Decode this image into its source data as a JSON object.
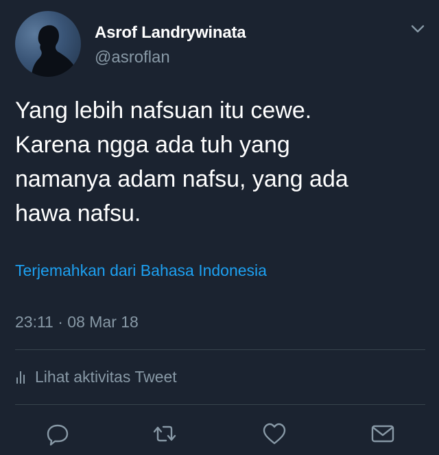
{
  "user": {
    "display_name": "Asrof Landrywinata",
    "handle": "@asroflan",
    "avatar_icon": "avatar-silhouette"
  },
  "tweet": {
    "text_lines": [
      "Yang lebih nafsuan itu cewe.",
      "Karena ngga ada tuh yang",
      "namanya adam nafsu, yang ada",
      "hawa nafsu."
    ],
    "translate_label": "Terjemahkan dari Bahasa Indonesia",
    "timestamp": "23:11 · 08 Mar 18",
    "activity_label": "Lihat aktivitas Tweet"
  },
  "actions": {
    "reply_icon": "reply-icon",
    "retweet_icon": "retweet-icon",
    "like_icon": "like-icon",
    "dm_icon": "mail-icon"
  },
  "colors": {
    "background": "#1b2330",
    "text_primary": "#ffffff",
    "text_secondary": "#8899a6",
    "link": "#1da1f2",
    "divider": "#38444d"
  }
}
